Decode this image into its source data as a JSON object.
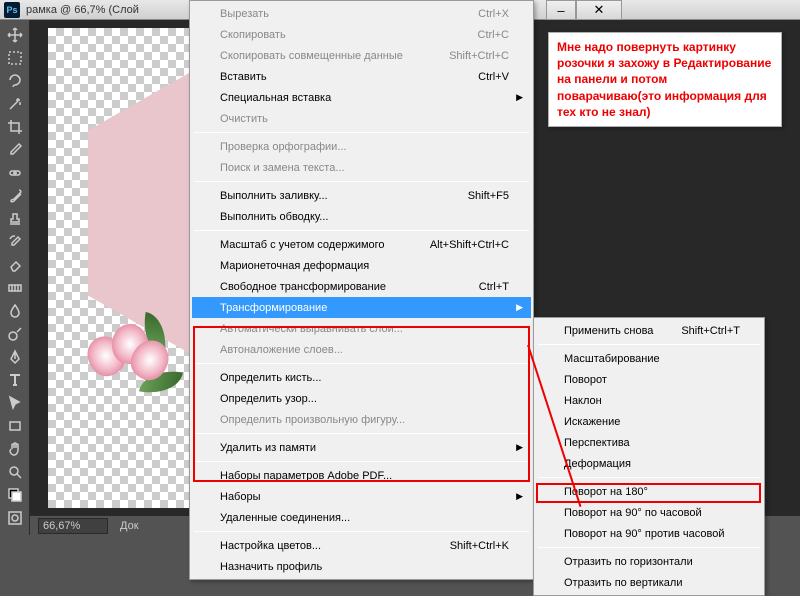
{
  "titlebar": {
    "title": "рамка @ 66,7% (Слой"
  },
  "window_controls": {
    "minimize": "–",
    "close": "✕"
  },
  "zoom": "66,67%",
  "status_doc": "Док",
  "annotation": "Мне надо повернуть картинку розочки я захожу в Редактирование на панели и потом поварачиваю(это информация для тех кто не знал)",
  "menu": {
    "cut": {
      "label": "Вырезать",
      "sc": "Ctrl+X"
    },
    "copy": {
      "label": "Скопировать",
      "sc": "Ctrl+C"
    },
    "copy_merged": {
      "label": "Скопировать совмещенные данные",
      "sc": "Shift+Ctrl+C"
    },
    "paste": {
      "label": "Вставить",
      "sc": "Ctrl+V"
    },
    "paste_special": {
      "label": "Специальная вставка"
    },
    "clear": {
      "label": "Очистить"
    },
    "spelling": {
      "label": "Проверка орфографии..."
    },
    "find": {
      "label": "Поиск и замена текста..."
    },
    "fill": {
      "label": "Выполнить заливку...",
      "sc": "Shift+F5"
    },
    "stroke": {
      "label": "Выполнить обводку..."
    },
    "content_aware": {
      "label": "Масштаб с учетом содержимого",
      "sc": "Alt+Shift+Ctrl+C"
    },
    "puppet": {
      "label": "Марионеточная деформация"
    },
    "free_transform": {
      "label": "Свободное трансформирование",
      "sc": "Ctrl+T"
    },
    "transform": {
      "label": "Трансформирование"
    },
    "auto_align": {
      "label": "Автоматически выравнивать слои..."
    },
    "auto_blend": {
      "label": "Автоналожение слоев..."
    },
    "define_brush": {
      "label": "Определить кисть..."
    },
    "define_pattern": {
      "label": "Определить узор..."
    },
    "define_shape": {
      "label": "Определить произвольную фигуру..."
    },
    "purge": {
      "label": "Удалить из памяти"
    },
    "pdf_presets": {
      "label": "Наборы параметров Adobe PDF..."
    },
    "presets": {
      "label": "Наборы"
    },
    "remote": {
      "label": "Удаленные соединения..."
    },
    "color_settings": {
      "label": "Настройка цветов...",
      "sc": "Shift+Ctrl+K"
    },
    "assign_profile": {
      "label": "Назначить профиль"
    }
  },
  "submenu": {
    "again": {
      "label": "Применить снова",
      "sc": "Shift+Ctrl+T"
    },
    "scale": {
      "label": "Масштабирование"
    },
    "rotate": {
      "label": "Поворот"
    },
    "skew": {
      "label": "Наклон"
    },
    "distort": {
      "label": "Искажение"
    },
    "perspective": {
      "label": "Перспектива"
    },
    "warp": {
      "label": "Деформация"
    },
    "rot180": {
      "label": "Поворот на 180°"
    },
    "rot90cw": {
      "label": "Поворот на 90° по часовой"
    },
    "rot90ccw": {
      "label": "Поворот на 90° против часовой"
    },
    "fliph": {
      "label": "Отразить по горизонтали"
    },
    "flipv": {
      "label": "Отразить по вертикали"
    }
  },
  "tools": [
    "move",
    "marquee",
    "lasso",
    "wand",
    "crop",
    "eyedropper",
    "healing",
    "brush",
    "stamp",
    "history-brush",
    "eraser",
    "gradient",
    "blur",
    "dodge",
    "pen",
    "type",
    "path-select",
    "rectangle",
    "hand",
    "zoom",
    "foreground-color",
    "quickmask"
  ]
}
